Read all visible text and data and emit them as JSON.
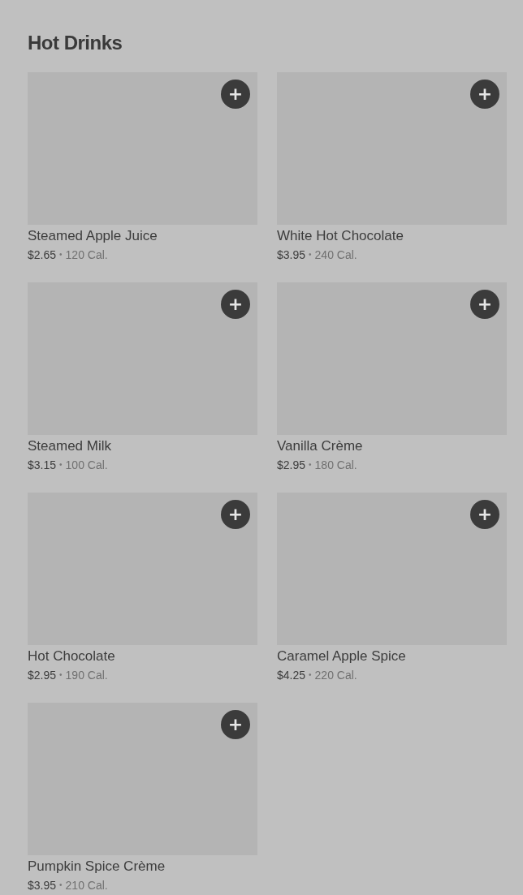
{
  "section": {
    "title": "Hot Drinks"
  },
  "items": [
    {
      "name": "Steamed Apple Juice",
      "price": "$2.65",
      "separator": "•",
      "calories": "120 Cal.",
      "add": "+"
    },
    {
      "name": "White Hot Chocolate",
      "price": "$3.95",
      "separator": "•",
      "calories": "240 Cal.",
      "add": "+"
    },
    {
      "name": "Steamed Milk",
      "price": "$3.15",
      "separator": "•",
      "calories": "100 Cal.",
      "add": "+"
    },
    {
      "name": "Vanilla Crème",
      "price": "$2.95",
      "separator": "•",
      "calories": "180 Cal.",
      "add": "+"
    },
    {
      "name": "Hot Chocolate",
      "price": "$2.95",
      "separator": "•",
      "calories": "190 Cal.",
      "add": "+"
    },
    {
      "name": "Caramel Apple Spice",
      "price": "$4.25",
      "separator": "•",
      "calories": "220 Cal.",
      "add": "+"
    },
    {
      "name": "Pumpkin Spice Crème",
      "price": "$3.95",
      "separator": "•",
      "calories": "210 Cal.",
      "add": "+"
    }
  ]
}
